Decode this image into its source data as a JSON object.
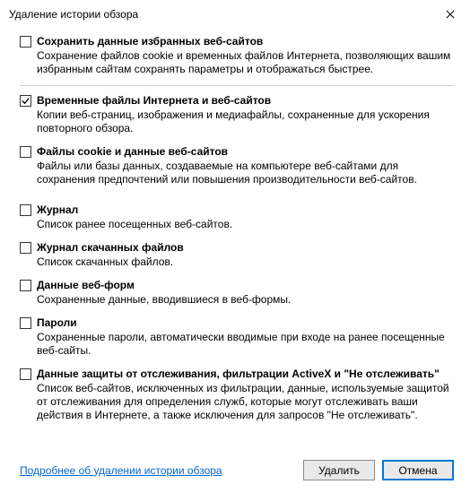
{
  "title": "Удаление истории обзора",
  "options": [
    {
      "checked": false,
      "title": "Сохранить данные избранных веб-сайтов",
      "desc": "Сохранение файлов cookie и временных файлов Интернета, позволяющих вашим избранным сайтам сохранять параметры и отображаться быстрее."
    },
    {
      "checked": true,
      "title": "Временные файлы Интернета и веб-сайтов",
      "desc": "Копии веб-страниц, изображения и медиафайлы, сохраненные для ускорения повторного обзора."
    },
    {
      "checked": false,
      "title": "Файлы cookie и данные веб-сайтов",
      "desc": "Файлы или базы данных, создаваемые на компьютере веб-сайтами для сохранения предпочтений или повышения производительности веб-сайтов."
    },
    {
      "checked": false,
      "title": "Журнал",
      "desc": "Список ранее посещенных веб-сайтов."
    },
    {
      "checked": false,
      "title": "Журнал скачанных файлов",
      "desc": "Список скачанных файлов."
    },
    {
      "checked": false,
      "title": "Данные веб-форм",
      "desc": "Сохраненные данные, вводившиеся в веб-формы."
    },
    {
      "checked": false,
      "title": "Пароли",
      "desc": "Сохраненные пароли, автоматически вводимые при входе на ранее посещенные веб-сайты."
    },
    {
      "checked": false,
      "title": "Данные защиты от отслеживания, фильтрации ActiveX и \"Не отслеживать\"",
      "desc": "Список веб-сайтов, исключенных из фильтрации, данные, используемые защитой от отслеживания для определения служб, которые могут отслеживать ваши действия в Интернете, а также исключения для запросов \"Не отслеживать\"."
    }
  ],
  "link": "Подробнее об удалении истории обзора",
  "buttons": {
    "delete": "Удалить",
    "cancel": "Отмена"
  }
}
